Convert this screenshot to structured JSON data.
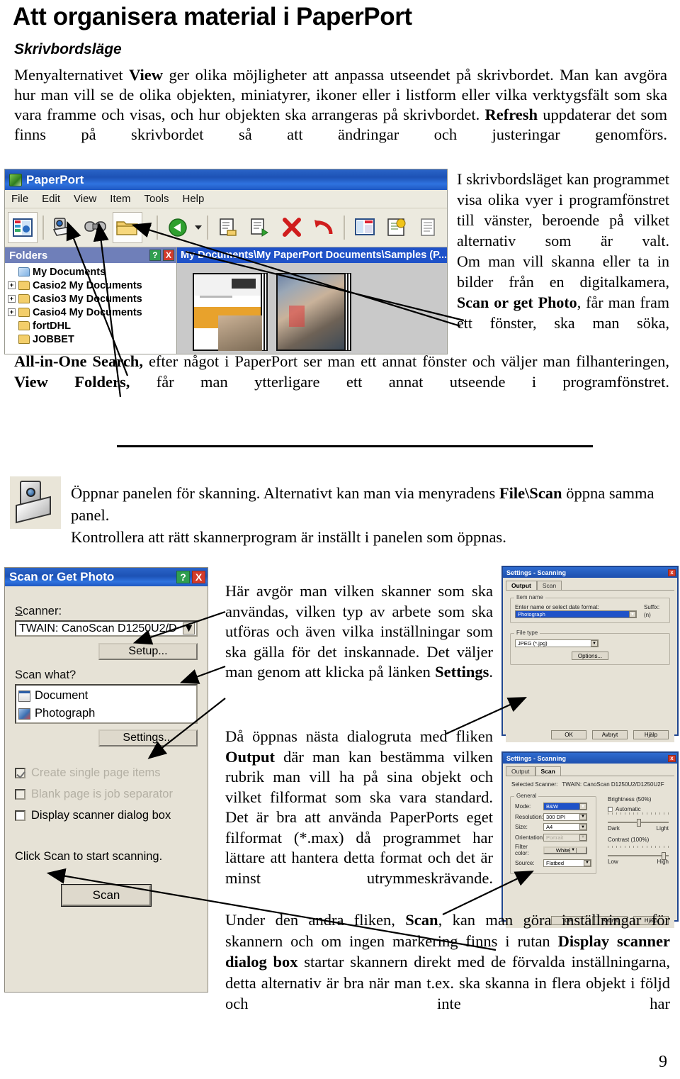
{
  "document": {
    "title": "Att organisera material i PaperPort",
    "subtitle": "Skrivbordsläge",
    "page_number": "9"
  },
  "intro": {
    "line1_a": "Menyalternativet ",
    "line1_b": "View",
    "line1_c": " ger olika möjligheter att anpassa utseendet på skrivbordet. Man kan avgöra hur man vill se de olika objekten, miniatyrer, ikoner eller i listform eller vilka verktygsfält som ska vara framme och visas, och hur objekten ska arrangeras på skrivbordet. ",
    "line1_d": "Refresh",
    "line1_e": " uppdaterar det som finns på skrivbordet så att ändringar och justeringar genomförs."
  },
  "right_column": {
    "p1": "I skrivbordsläget kan programmet visa olika vyer i programfönstret till vänster, beroende på vilket alternativ som är valt.",
    "p2_a": "Om man vill skanna eller ta in bilder från en digitalkamera, ",
    "p2_b": "Scan or get Photo",
    "p2_c": ", får man fram ett fönster, ska man söka,"
  },
  "below_screenshot": {
    "a": "All-in-One Search,",
    "b": " efter något i PaperPort ser man ett annat fönster och väljer man filhanteringen, ",
    "c": "View Folders,",
    "d": " får man ytterligare ett annat utseende i programfönstret."
  },
  "scanner_paragraph": {
    "a": "Öppnar panelen för skanning. Alternativt kan man via menyradens ",
    "b": "File\\Scan",
    "c": " öppna samma panel.",
    "d": "Kontrollera att rätt skannerprogram är inställt i panelen som öppnas."
  },
  "middle_column": {
    "p1_a": "Här avgör man vilken skanner som ska användas, vilken typ av arbete som ska utföras och även vilka inställningar som ska gälla för det inskannade. Det väljer man genom att klicka på länken ",
    "p1_b": "Settings",
    "p1_c": ".",
    "p2_a": "Då öppnas nästa dialogruta med fliken ",
    "p2_b": "Output",
    "p2_c": " där man kan bestämma vilken rubrik man vill ha på sina objekt och vilket filformat som ska vara standard. Det är bra att använda PaperPorts eget filformat (*.max) då programmet har lättare att hantera detta format och det är minst utrymmeskrävande.",
    "p3_a": "Under den andra fliken, ",
    "p3_b": "Scan",
    "p3_c": ", kan man göra inställningar för skannern och om ingen markering finns i rutan ",
    "p3_d": "Display scanner dialog box",
    "p3_e": " startar skannern direkt med de förvalda inställningarna, detta alternativ är bra när man t.ex. ska skanna in flera objekt i följd och inte har"
  },
  "paperport_window": {
    "title": "PaperPort",
    "menus": [
      "File",
      "Edit",
      "View",
      "Item",
      "Tools",
      "Help"
    ],
    "folders_header": "Folders",
    "folders_help_label": "?",
    "folders_close_label": "X",
    "tree": [
      {
        "label": "My Documents",
        "expander": "",
        "root": true
      },
      {
        "label": "Casio2 My Documents",
        "expander": "+",
        "root": false
      },
      {
        "label": "Casio3 My Documents",
        "expander": "+",
        "root": false
      },
      {
        "label": "Casio4 My Documents",
        "expander": "+",
        "root": false
      },
      {
        "label": "fortDHL",
        "expander": "",
        "root": false
      },
      {
        "label": "JOBBET",
        "expander": "",
        "root": false
      }
    ],
    "path_bar": "My Documents\\My PaperPort Documents\\Samples (P...",
    "toolbar_icons": [
      "view-folders-icon",
      "scan-or-get-photo-icon",
      "all-in-one-search-icon",
      "folder-icon",
      "back-arrow-icon",
      "send-to-icon",
      "copy-icon",
      "delete-icon",
      "undo-icon",
      "properties-icon",
      "annotate-icon",
      "page-icon"
    ]
  },
  "scan_dialog": {
    "title": "Scan or Get Photo",
    "help_label": "?",
    "close_label": "X",
    "scanner_label": "Scanner:",
    "scanner_value": "TWAIN: CanoScan D1250U2/D",
    "setup_button": "Setup...",
    "scan_what_label": "Scan what?",
    "items": [
      "Document",
      "Photograph"
    ],
    "settings_button": "Settings...",
    "checkboxes": [
      {
        "label": "Create single page items",
        "checked": true,
        "disabled": true
      },
      {
        "label": "Blank page is job separator",
        "checked": false,
        "disabled": true
      },
      {
        "label": "Display scanner dialog box",
        "checked": false,
        "disabled": false
      }
    ],
    "hint": "Click Scan to start scanning.",
    "scan_button": "Scan"
  },
  "settings_output": {
    "title": "Settings - Scanning",
    "close_label": "x",
    "tabs": [
      "Output",
      "Scan"
    ],
    "active_tab": "Output",
    "group_item_name": "Item name",
    "name_label": "Enter name or select date format:",
    "name_value": "Photograph",
    "suffix_label": "Suffix:",
    "suffix_value": "(n)",
    "group_file_type": "File type",
    "file_type_value": "JPEG (*.jpg)",
    "options_button": "Options...",
    "ok_button": "OK",
    "cancel_button": "Avbryt",
    "help_button": "Hjälp"
  },
  "settings_scan": {
    "title": "Settings - Scanning",
    "close_label": "x",
    "tabs": [
      "Output",
      "Scan"
    ],
    "active_tab": "Scan",
    "selected_scanner_label": "Selected Scanner:",
    "selected_scanner_value": "TWAIN: CanoScan D1250U2/D1250U2F",
    "group_general": "General",
    "fields": [
      {
        "label": "Mode:",
        "value": "B&W",
        "selected": true,
        "disabled": false
      },
      {
        "label": "Resolution:",
        "value": "300 DPI",
        "selected": false,
        "disabled": false
      },
      {
        "label": "Size:",
        "value": "A4",
        "selected": false,
        "disabled": false
      },
      {
        "label": "Orientation:",
        "value": "Portrait",
        "selected": false,
        "disabled": true
      },
      {
        "label": "Filter color:",
        "value": "White",
        "selected": false,
        "disabled": false
      },
      {
        "label": "Source:",
        "value": "Flatbed",
        "selected": false,
        "disabled": false
      }
    ],
    "brightness_label": "Brightness (50%)",
    "automatic_label": "Automatic",
    "dark_label": "Dark",
    "light_label": "Light",
    "contrast_label": "Contrast (100%)",
    "low_label": "Low",
    "high_label": "High",
    "ok_button": "OK",
    "cancel_button": "Avbryt",
    "help_button": "Hjälp"
  }
}
